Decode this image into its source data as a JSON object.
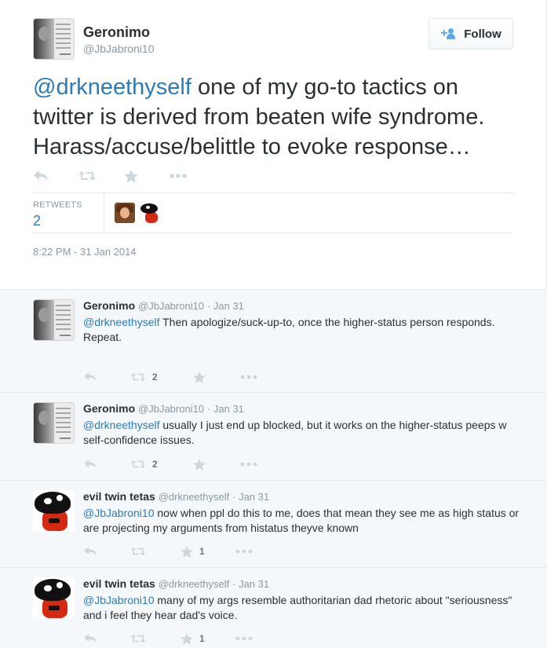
{
  "main_tweet": {
    "author_name": "Geronimo",
    "author_handle": "@JbJabroni10",
    "follow_label": "Follow",
    "mention": "@drkneethyself",
    "text": " one of my go-to tactics on twitter is derived from beaten wife syndrome. Harass/accuse/belittle to evoke response…",
    "retweets_label": "RETWEETS",
    "retweets_count": "2",
    "timestamp": "8:22 PM - 31 Jan 2014"
  },
  "replies": [
    {
      "name": "Geronimo",
      "handle": "@JbJabroni10",
      "date": "· Jan 31",
      "mention": "@drkneethyself",
      "text": " Then apologize/suck-up-to, once the higher-status person responds.",
      "text2": "Repeat.",
      "retweet_count": "2",
      "favorite_count": "",
      "avatar": "quote-avatar"
    },
    {
      "name": "Geronimo",
      "handle": "@JbJabroni10",
      "date": "· Jan 31",
      "mention": "@drkneethyself",
      "text": " usually I just end up blocked, but it works on the higher-status peeps w self-confidence issues.",
      "retweet_count": "2",
      "favorite_count": "",
      "avatar": "quote-avatar"
    },
    {
      "name": "evil twin tetas",
      "handle": "@drkneethyself",
      "date": "· Jan 31",
      "mention": "@JbJabroni10",
      "text": " now when ppl do this to me, does that mean they see me as high status or are projecting my arguments from histatus theyve known",
      "retweet_count": "",
      "favorite_count": "1",
      "avatar": "spy-avatar"
    },
    {
      "name": "evil twin tetas",
      "handle": "@drkneethyself",
      "date": "· Jan 31",
      "mention": "@JbJabroni10",
      "text": " many of my args resemble authoritarian dad rhetoric about \"seriousness\" and i feel they hear dad's voice.",
      "retweet_count": "",
      "favorite_count": "1",
      "avatar": "spy-avatar"
    }
  ],
  "colors": {
    "link": "#2b7bb9",
    "muted": "#8899a6",
    "icon": "#ccd6dd",
    "reply_bg": "#f5f8fa"
  },
  "icons": [
    "reply-icon",
    "retweet-icon",
    "favorite-icon",
    "more-icon",
    "follow-person-icon"
  ]
}
